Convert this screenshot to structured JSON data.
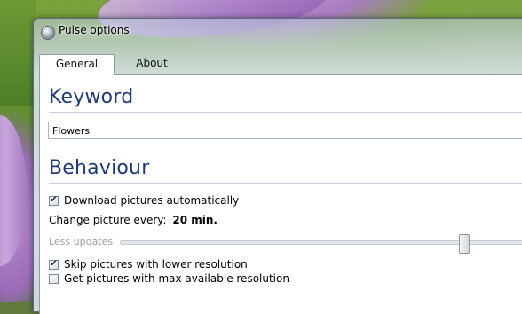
{
  "window": {
    "title": "Pulse options",
    "icon": "pulse-app-icon"
  },
  "tabs": [
    {
      "label": "General",
      "active": true
    },
    {
      "label": "About",
      "active": false
    }
  ],
  "keyword": {
    "heading": "Keyword",
    "value": "Flowers"
  },
  "behaviour": {
    "heading": "Behaviour",
    "download_automatically": {
      "label": "Download pictures automatically",
      "checked": true
    },
    "change_picture": {
      "label": "Change picture every:",
      "value": "20 min."
    },
    "slider": {
      "left_label": "Less updates",
      "level": 0.85
    },
    "skip_lower_resolution": {
      "label": "Skip pictures with lower resolution",
      "checked": true
    },
    "max_resolution": {
      "label": "Get pictures with max available resolution",
      "checked": false
    }
  },
  "colors": {
    "heading": "#1e3b78",
    "disabled_text": "#9aa0a8"
  }
}
